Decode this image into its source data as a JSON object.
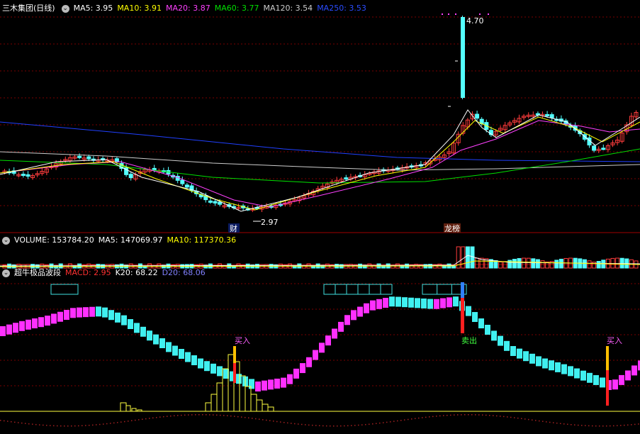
{
  "colors": {
    "up": "#ff3c3c",
    "down": "#54ffff",
    "ma5": "#ffffff",
    "ma10": "#ffff00",
    "ma20": "#ff40ff",
    "ma60": "#00e000",
    "ma120": "#cccccc",
    "ma250": "#2040ff",
    "grid": "#7a0000",
    "divider": "#a00000"
  },
  "price_pane": {
    "title": "三木集团(日线)",
    "collapse_icon": "chevron-down-icon",
    "ma5": "MA5: 3.95",
    "ma10": "MA10: 3.91",
    "ma20": "MA20: 3.87",
    "ma60": "MA60: 3.77",
    "ma120": "MA120: 3.54",
    "ma250": "MA250: 3.53",
    "high_label": "4.70",
    "low_label": "2.97",
    "event_marker_1": "财",
    "event_marker_2": "龙榜"
  },
  "volume_pane": {
    "volume": "VOLUME: 153784.20",
    "ma5": "MA5: 147069.97",
    "ma10": "MA10: 117370.36"
  },
  "indicator_pane": {
    "title": "超牛极品波段",
    "macd": "MACD: 2.95",
    "k20": "K20: 68.22",
    "d20": "D20: 68.06",
    "signals": [
      "买入",
      "卖出",
      "买入"
    ]
  }
}
